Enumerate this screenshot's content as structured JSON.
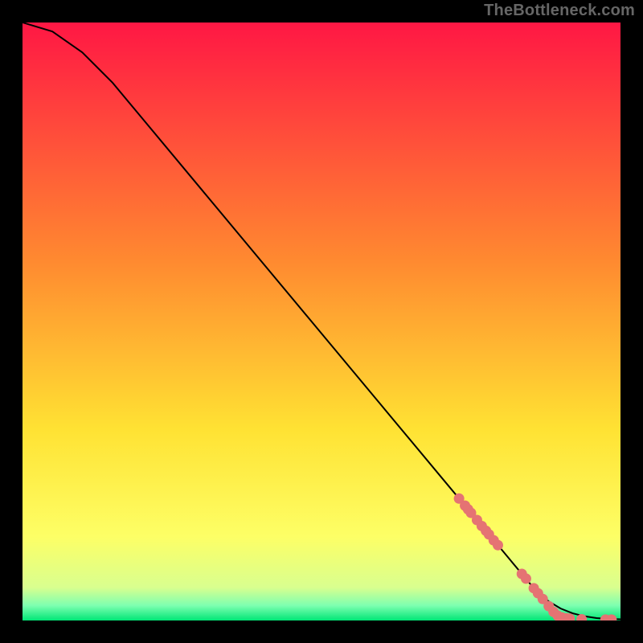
{
  "attribution": "TheBottleneck.com",
  "chart_data": {
    "type": "line",
    "title": "",
    "xlabel": "",
    "ylabel": "",
    "xlim": [
      0,
      100
    ],
    "ylim": [
      0,
      100
    ],
    "grid": false,
    "background_gradient": {
      "direction": "vertical",
      "stops": [
        {
          "pos": 0.0,
          "color": "#ff1744"
        },
        {
          "pos": 0.4,
          "color": "#ff8a30"
        },
        {
          "pos": 0.68,
          "color": "#ffe233"
        },
        {
          "pos": 0.86,
          "color": "#fdff66"
        },
        {
          "pos": 0.945,
          "color": "#d9ff8f"
        },
        {
          "pos": 0.975,
          "color": "#7dffb0"
        },
        {
          "pos": 1.0,
          "color": "#00e676"
        }
      ]
    },
    "series": [
      {
        "name": "curve",
        "type": "line",
        "color": "#000000",
        "x": [
          0,
          5,
          10,
          15,
          20,
          30,
          40,
          50,
          60,
          70,
          78,
          84,
          86,
          88,
          90,
          92,
          94,
          96,
          98,
          100
        ],
        "y": [
          100,
          98.5,
          95,
          90,
          84,
          72,
          60,
          48,
          36,
          24,
          14.4,
          7.2,
          4.8,
          3.2,
          2.0,
          1.2,
          0.7,
          0.4,
          0.25,
          0.2
        ]
      },
      {
        "name": "points",
        "type": "scatter",
        "color": "#e57373",
        "x": [
          73,
          74,
          74.5,
          75,
          76,
          76.8,
          77.5,
          78,
          78.8,
          79.5,
          83.5,
          84.2,
          85.5,
          86.2,
          87,
          88,
          88.8,
          89.5,
          90.2,
          91,
          91.5,
          93.5,
          97.5,
          98.5
        ],
        "y": [
          20.4,
          19.2,
          18.6,
          18.0,
          16.8,
          15.8,
          15.0,
          14.4,
          13.4,
          12.6,
          7.8,
          7.0,
          5.4,
          4.56,
          3.6,
          2.4,
          1.44,
          0.8,
          0.5,
          0.35,
          0.3,
          0.2,
          0.15,
          0.15
        ]
      }
    ]
  }
}
